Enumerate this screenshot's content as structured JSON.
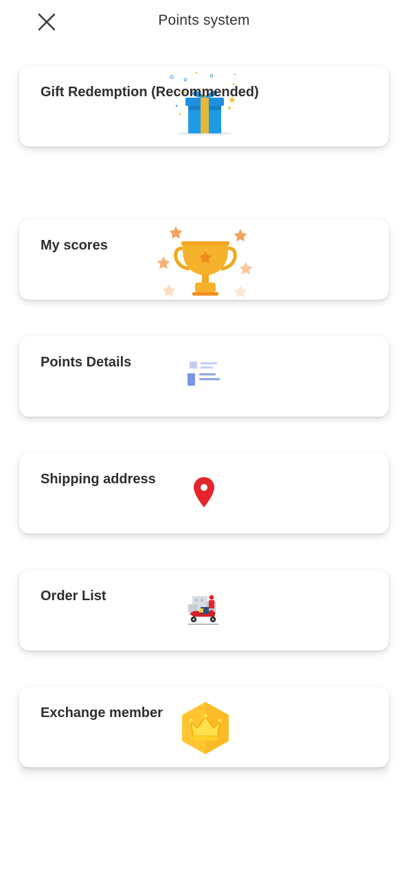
{
  "header": {
    "title": "Points system",
    "close_icon": "close-icon"
  },
  "menu": {
    "items": [
      {
        "label": "Gift Redemption (Recommended)",
        "icon": "gift-box-icon"
      },
      {
        "label": "My scores",
        "icon": "trophy-icon"
      },
      {
        "label": "Points Details",
        "icon": "list-details-icon"
      },
      {
        "label": "Shipping address",
        "icon": "map-pin-icon"
      },
      {
        "label": "Order List",
        "icon": "delivery-scooter-icon"
      },
      {
        "label": "Exchange member",
        "icon": "crown-hexagon-icon"
      }
    ]
  },
  "colors": {
    "text_primary": "#2e2e2e",
    "gift_blue": "#1e9be6",
    "gift_ribbon": "#e2b93b",
    "trophy_gold": "#f6b12d",
    "star_orange": "#f5a25d",
    "details_blue": "#7b93e8",
    "pin_red": "#e3262b",
    "crown_gold": "#ffc533"
  }
}
